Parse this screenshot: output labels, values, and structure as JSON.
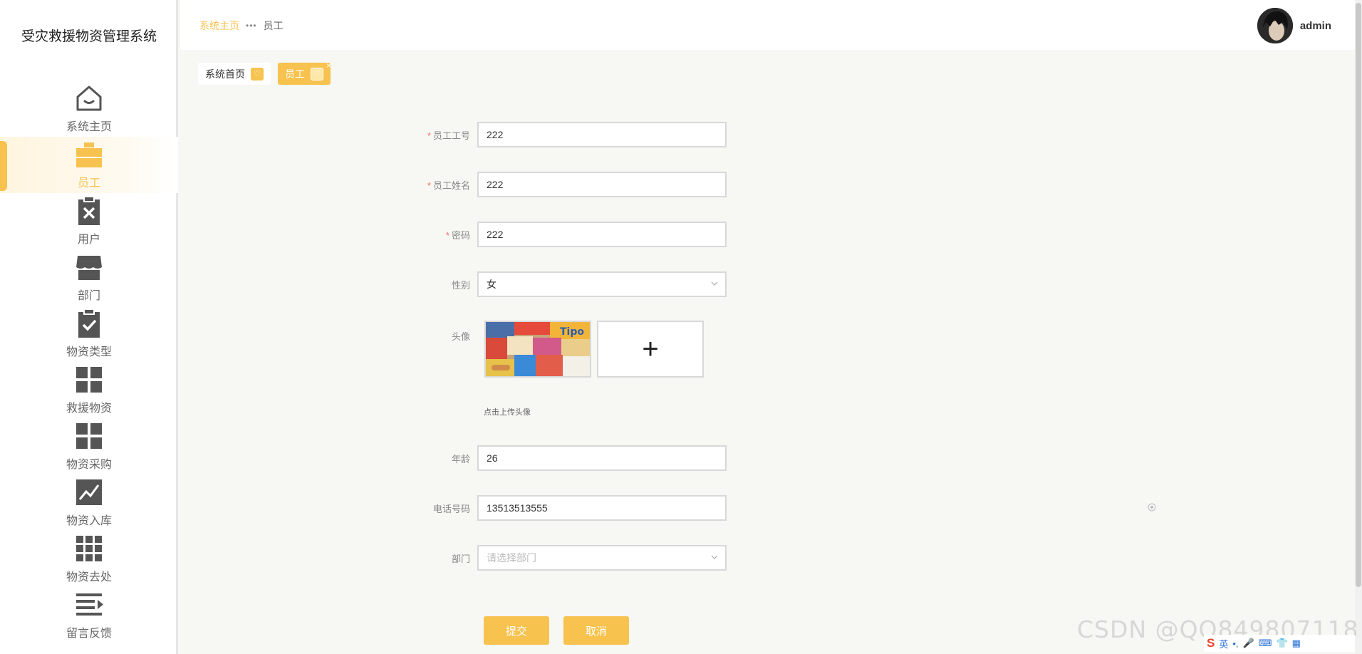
{
  "app": {
    "title": "受灾救援物资管理系统"
  },
  "sidebar": {
    "items": [
      {
        "label": "系统主页",
        "icon": "home-icon"
      },
      {
        "label": "员工",
        "icon": "briefcase-icon",
        "active": true
      },
      {
        "label": "用户",
        "icon": "clipboard-x-icon"
      },
      {
        "label": "部门",
        "icon": "store-icon"
      },
      {
        "label": "物资类型",
        "icon": "clipboard-check-icon"
      },
      {
        "label": "救援物资",
        "icon": "grid-icon"
      },
      {
        "label": "物资采购",
        "icon": "grid-icon"
      },
      {
        "label": "物资入库",
        "icon": "chart-icon"
      },
      {
        "label": "物资去处",
        "icon": "apps-icon"
      },
      {
        "label": "留言反馈",
        "icon": "list-icon"
      }
    ]
  },
  "header": {
    "breadcrumb_home": "系统主页",
    "breadcrumb_sep": "•••",
    "breadcrumb_current": "员工",
    "username": "admin"
  },
  "tags": [
    {
      "label": "系统首页"
    },
    {
      "label": "员工",
      "active": true,
      "close": "×"
    }
  ],
  "form": {
    "employee_no": {
      "label": "员工工号",
      "value": "222",
      "required": "*"
    },
    "employee_name": {
      "label": "员工姓名",
      "value": "222",
      "required": "*"
    },
    "password": {
      "label": "密码",
      "value": "222",
      "required": "*"
    },
    "gender": {
      "label": "性别",
      "value": "女"
    },
    "avatar": {
      "label": "头像",
      "hint": "点击上传头像",
      "add": "+"
    },
    "age": {
      "label": "年龄",
      "value": "26"
    },
    "phone": {
      "label": "电话号码",
      "value": "13513513555"
    },
    "department": {
      "label": "部门",
      "placeholder": "请选择部门"
    },
    "submit": "提交",
    "cancel": "取消"
  },
  "watermark": "CSDN @QQ849807118",
  "ime": {
    "lang": "英"
  },
  "colors": {
    "accent": "#f7c24d",
    "required": "#f56c6c"
  }
}
